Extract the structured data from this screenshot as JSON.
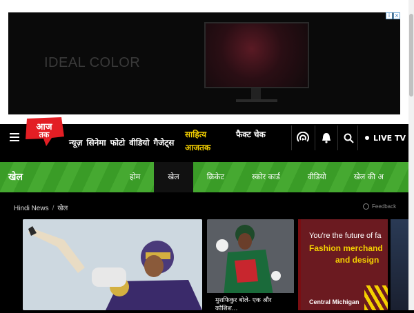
{
  "ad": {
    "text": "IDEAL COLOR"
  },
  "header": {
    "logo_alt": "आज तक",
    "nav": [
      "न्यूज़",
      "सिनेमा",
      "फोटो",
      "वीडियो",
      "गैजेट्स"
    ],
    "sahitya": "साहित्य आजतक",
    "fact_check": "फैक्ट चेक",
    "live_tv": "LIVE TV"
  },
  "section": {
    "title": "खेल",
    "tabs": [
      "होम",
      "खेल",
      "क्रिकेट",
      "स्कोर कार्ड",
      "वीडियो",
      "खेल की अ"
    ],
    "active_tab": "खेल"
  },
  "breadcrumb": {
    "home": "Hindi News",
    "current": "खेल"
  },
  "feedback": "Feedback",
  "cards": {
    "second_caption": "मुशफिकुर बोले- एक और कोशिश..."
  },
  "promo": {
    "line1": "You're the future of fa",
    "line2": "Fashion merchand",
    "line3": "and design",
    "line4": "Central Michigan"
  },
  "colors": {
    "section_green": "#3ea629",
    "logo_red": "#e31e24",
    "accent_yellow": "#f4d000"
  }
}
